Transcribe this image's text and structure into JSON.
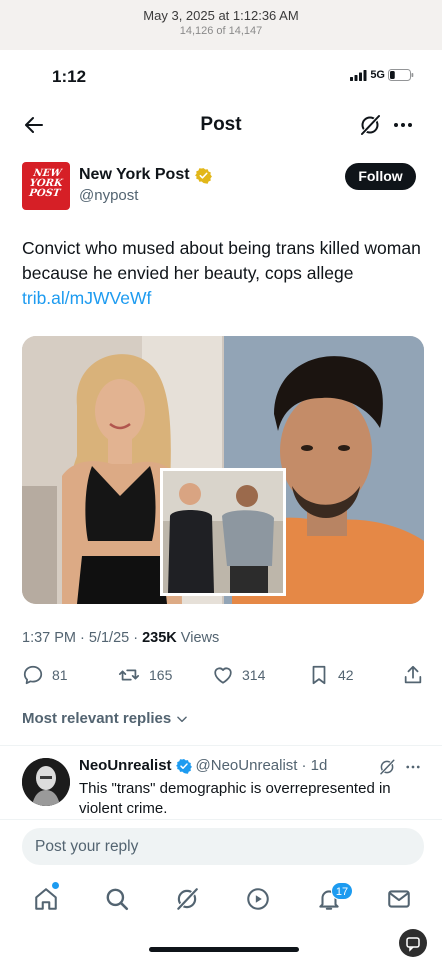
{
  "photos_header": {
    "date": "May 3, 2025 at 1:12:36 AM",
    "count": "14,126 of 14,147"
  },
  "status_bar": {
    "time": "1:12",
    "network": "5G",
    "battery_percent": 25
  },
  "nav": {
    "title": "Post"
  },
  "author": {
    "logo_lines": [
      "NEW",
      "YORK",
      "POST"
    ],
    "name": "New York Post",
    "handle": "@nypost",
    "verified_color": "#e2b719",
    "follow_label": "Follow"
  },
  "post": {
    "text": "Convict who mused about being trans killed woman because he envied her beauty, cops allege ",
    "link": "trib.al/mJWVeWf"
  },
  "meta": {
    "time": "1:37 PM",
    "separator": " · ",
    "date": "5/1/25",
    "views_count": "235K",
    "views_label": " Views"
  },
  "actions": {
    "replies": "81",
    "reposts": "165",
    "likes": "314",
    "bookmarks": "42"
  },
  "replies_section": {
    "toggle_label": "Most relevant replies"
  },
  "reply": {
    "name": "NeoUnrealist",
    "handle": "@NeoUnrealist",
    "time": "· 1d",
    "text": "This \"trans\" demographic is overrepresented in violent crime.",
    "verified_color": "#1d9bf0"
  },
  "composer": {
    "placeholder": "Post your reply"
  },
  "tab_bar": {
    "notifications_badge": "17"
  },
  "colors": {
    "accent": "#1d9bf0",
    "brand_red": "#d61f26",
    "text": "#0f1419",
    "muted": "#536471"
  }
}
